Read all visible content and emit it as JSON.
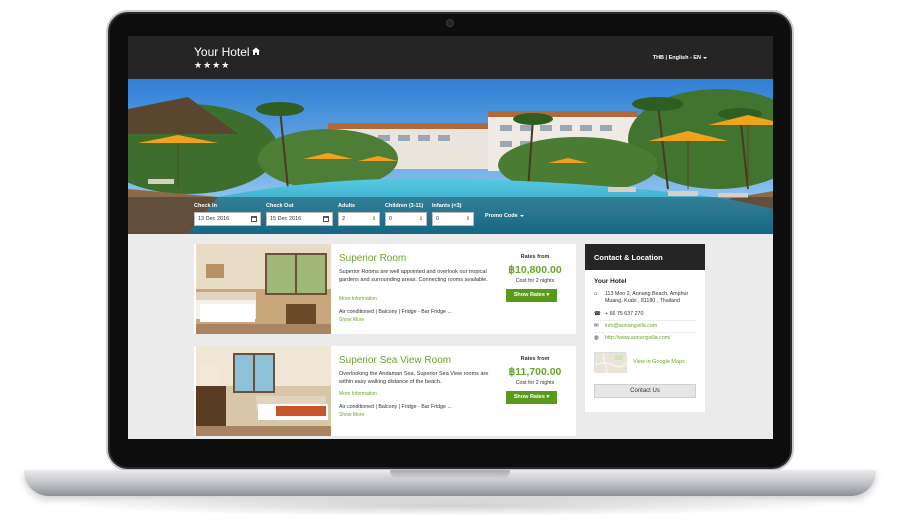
{
  "header": {
    "hotel_name": "Your Hotel",
    "stars": "★★★★",
    "language": "THB | English - EN"
  },
  "search": {
    "checkin_label": "Check In",
    "checkin_value": "13 Dec 2016",
    "checkout_label": "Check Out",
    "checkout_value": "15 Dec 2016",
    "adults_label": "Adults",
    "adults_value": "2",
    "children_label": "Children (3-11)",
    "children_value": "0",
    "infants_label": "Infants (<3)",
    "infants_value": "0",
    "promo_label": "Promo Code"
  },
  "rooms": [
    {
      "title": "Superior Room",
      "description": "Superior Rooms are well appointed and overlook our tropical gardens and surrounding areas. Connecting rooms available.",
      "more_info": "More Information",
      "amenities": "Air conditioned | Balcony | Fridge - Bar Fridge ...",
      "show_more": "Show More",
      "rates_from": "Rates from",
      "price": "฿10,800.00",
      "cost_note": "Cost for 2 nights",
      "button": "Show Rates"
    },
    {
      "title": "Superior Sea View Room",
      "description": "Overlooking the Andaman Sea, Superior Sea View rooms are within easy walking distance of the beach.",
      "more_info": "More Information",
      "amenities": "Air conditioned | Balcony | Fridge - Bar Fridge ...",
      "show_more": "Show More",
      "rates_from": "Rates from",
      "price": "฿11,700.00",
      "cost_note": "Cost for 2 nights",
      "button": "Show Rates"
    }
  ],
  "contact": {
    "heading": "Contact & Location",
    "name": "Your Hotel",
    "address": "113 Moo 2, Aonang Beach, Amphur Muang, Krabi , 81180 , Thailand",
    "phone": "+ 66 75 637 270",
    "email": "info@aonangvilla.com",
    "website": "http://www.aonangvilla.com/",
    "map_link": "View in Google Maps",
    "button": "Contact Us"
  },
  "icons": {
    "home": "home-icon",
    "calendar": "calendar-icon",
    "address": "home-icon",
    "phone": "phone-icon",
    "email": "envelope-icon",
    "website": "globe-icon"
  },
  "colors": {
    "accent_green": "#6aa52a",
    "button_green": "#5a9a1a",
    "header_dark": "#252525"
  }
}
